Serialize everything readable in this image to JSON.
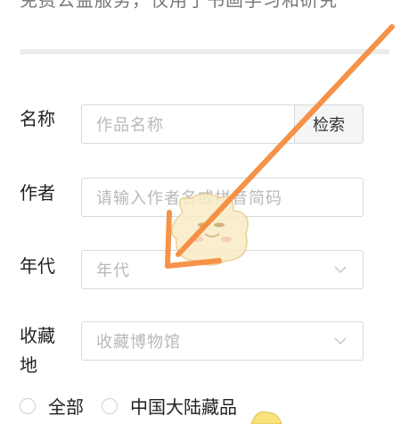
{
  "header": {
    "subtitle": "免费公益服务，仅用于书画学习和研究"
  },
  "form": {
    "name": {
      "label": "名称",
      "placeholder": "作品名称",
      "button": "检索"
    },
    "author": {
      "label": "作者",
      "placeholder": "请输入作者名或拼音简码"
    },
    "era": {
      "label": "年代",
      "placeholder": "年代"
    },
    "collection": {
      "label_line1": "收藏",
      "label_line2": "地",
      "placeholder": "收藏博物馆"
    },
    "scope": {
      "options": [
        "全部",
        "中国大陆藏品"
      ]
    }
  },
  "colors": {
    "arrow": "#f5893a",
    "border": "#d9d9d9",
    "placeholder": "#b8b8b8"
  },
  "icons": [
    "chevron-down-icon",
    "orange-arrow-annotation",
    "mascot-sticker"
  ]
}
